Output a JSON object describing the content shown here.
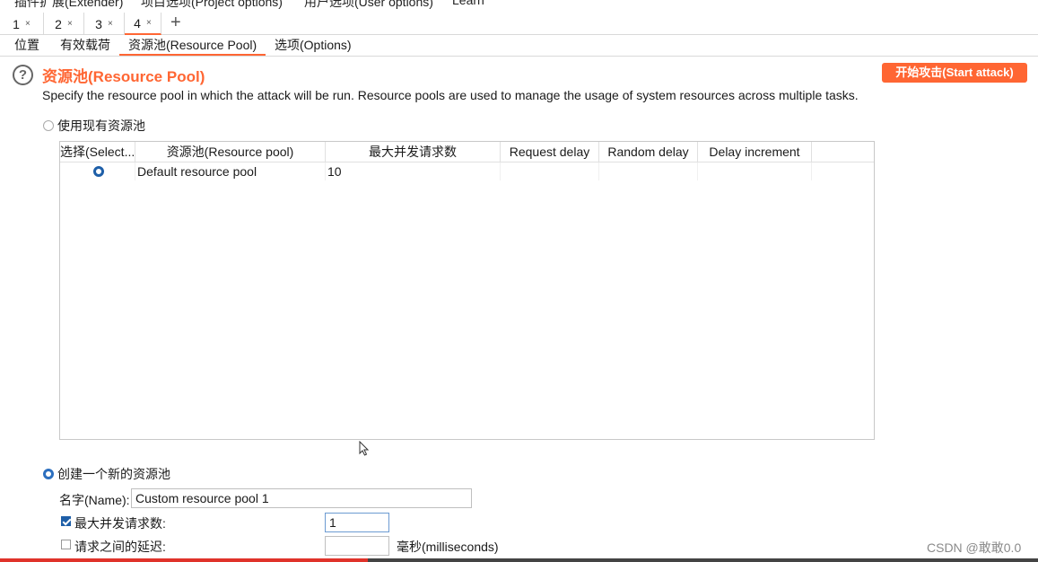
{
  "menu": {
    "items": [
      "插件扩展(Extender)",
      "项目选项(Project options)",
      "用户选项(User options)",
      "Learn"
    ]
  },
  "tabs": {
    "items": [
      {
        "label": "1",
        "close": "×"
      },
      {
        "label": "2",
        "close": "×"
      },
      {
        "label": "3",
        "close": "×"
      },
      {
        "label": "4",
        "close": "×"
      }
    ],
    "add": "+"
  },
  "subtabs": [
    "位置",
    "有效载荷",
    "资源池(Resource Pool)",
    "选项(Options)"
  ],
  "header": {
    "help": "?",
    "title": "资源池(Resource Pool)",
    "description": "Specify the resource pool in which the attack will be run. Resource pools are used to manage the usage of system resources across multiple tasks.",
    "start_button": "开始攻击(Start attack)"
  },
  "existing": {
    "label": "使用现有资源池",
    "columns": [
      "选择(Select...",
      "资源池(Resource pool)",
      "最大并发请求数",
      "Request delay",
      "Random delay",
      "Delay increment"
    ],
    "rows": [
      {
        "name": "Default resource pool",
        "max": "10",
        "request_delay": "",
        "random_delay": "",
        "increment": ""
      }
    ]
  },
  "create": {
    "label": "创建一个新的资源池",
    "name_label": "名字(Name):",
    "name_value": "Custom resource pool 1",
    "max_label": "最大并发请求数:",
    "max_value": "1",
    "delay_label": "请求之间的延迟:",
    "delay_value": "",
    "delay_unit": "毫秒(milliseconds)"
  },
  "watermark": "CSDN @敢敢0.0",
  "colors": {
    "accent": "#ff6633",
    "radio": "#1e5fa8"
  }
}
